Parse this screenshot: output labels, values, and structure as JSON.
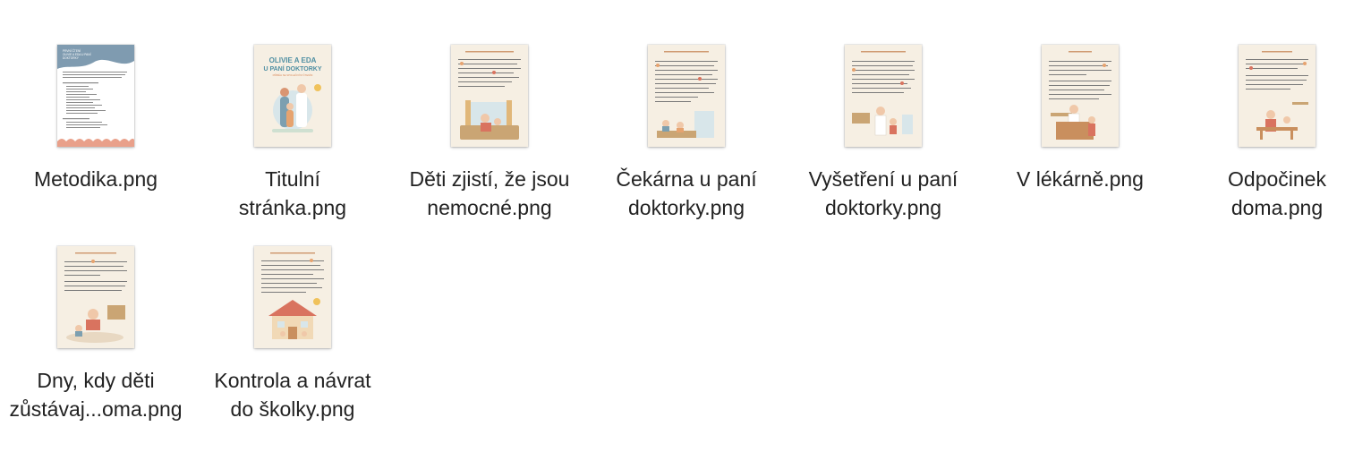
{
  "files": [
    {
      "label": "Metodika.png",
      "thumb_title": "PRVNÍ ČTENÍ\nOLIVIE A EDA U PANÍ\nDOKTORKY",
      "thumb_kind": "doc-blue",
      "icon": "png-document-thumbnail-icon"
    },
    {
      "label": "Titulní\nstránka.png",
      "thumb_title": "OLIVIE A EDA\nU PANÍ DOKTORKY",
      "thumb_subtitle": "PŘÍBĚH SE SPOLEČNÝM ČTENÍM",
      "thumb_kind": "cover",
      "icon": "png-document-thumbnail-icon"
    },
    {
      "label": "Děti zjistí, že jsou\nnemocné.png",
      "thumb_kind": "story-bottom",
      "icon": "png-document-thumbnail-icon"
    },
    {
      "label": "Čekárna u paní\ndoktorky.png",
      "thumb_kind": "story-bottom",
      "icon": "png-document-thumbnail-icon"
    },
    {
      "label": "Vyšetření u paní\ndoktorky.png",
      "thumb_kind": "story-bottom",
      "icon": "png-document-thumbnail-icon"
    },
    {
      "label": "V lékárně.png",
      "thumb_kind": "story-bottom",
      "icon": "png-document-thumbnail-icon"
    },
    {
      "label": "Odpočinek\ndoma.png",
      "thumb_kind": "story-bottom",
      "icon": "png-document-thumbnail-icon"
    },
    {
      "label": "Dny, kdy děti\nzůstávaj...oma.png",
      "thumb_kind": "story-bottom",
      "icon": "png-document-thumbnail-icon"
    },
    {
      "label": "Kontrola a návrat\ndo školky.png",
      "thumb_kind": "story-house",
      "icon": "png-document-thumbnail-icon"
    }
  ],
  "colors": {
    "page_background": "#ffffff",
    "label_text": "#222222",
    "thumb_paper": "#f6efe3",
    "metodika_header": "#7f9bb0",
    "cover_title": "#4f8fa3",
    "accent_orange": "#e6a36f",
    "accent_red": "#d9735f"
  }
}
